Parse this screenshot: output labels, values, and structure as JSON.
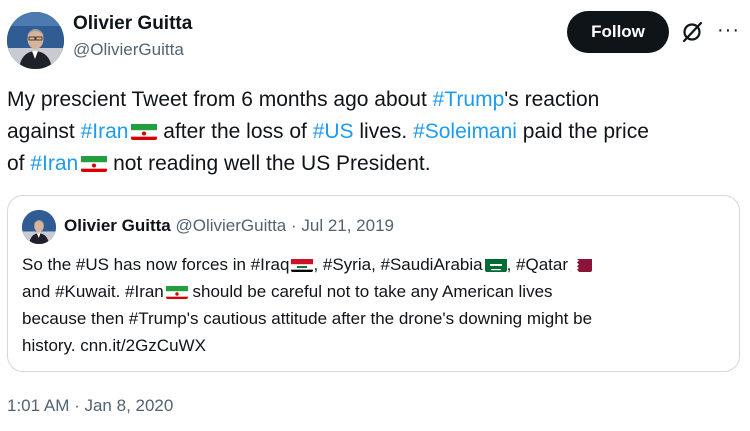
{
  "author": {
    "name": "Olivier Guitta",
    "handle": "@OlivierGuitta"
  },
  "follow_label": "Follow",
  "more_label": "···",
  "tweet": {
    "l1": {
      "a": "My prescient Tweet from 6 months ago about ",
      "h1": "#Trump",
      "b": "'s reaction"
    },
    "l2": {
      "a": "against ",
      "h1": "#Iran",
      "b": " after the loss of ",
      "h2": "#US",
      "c": " lives. ",
      "h3": "#Soleimani",
      "d": " paid the price"
    },
    "l3": {
      "a": "of ",
      "h1": "#Iran",
      "b": " not reading well the US President."
    }
  },
  "quote": {
    "name": "Olivier Guitta",
    "meta": "@OlivierGuitta · Jul 21, 2019",
    "l1": {
      "a": "So the #US has now forces in #Iraq",
      "b": ", #Syria, #SaudiArabia",
      "c": ", #Qatar"
    },
    "l2": {
      "a": "and #Kuwait. #Iran",
      "b": " should be careful not to take any American lives"
    },
    "l3": "because then #Trump's cautious attitude after the drone's downing might be",
    "l4": "history. cnn.it/2GzCuWX"
  },
  "timestamp": "1:01 AM · Jan 8, 2020",
  "colors": {
    "link": "#1d9bf0",
    "text": "#0f1419",
    "muted": "#536471",
    "border": "#cfd9de",
    "button": "#0f1419"
  },
  "icons": [
    "grok-icon",
    "more-icon",
    "iran-flag-icon",
    "iraq-flag-icon",
    "saudi-flag-icon",
    "qatar-flag-icon"
  ]
}
